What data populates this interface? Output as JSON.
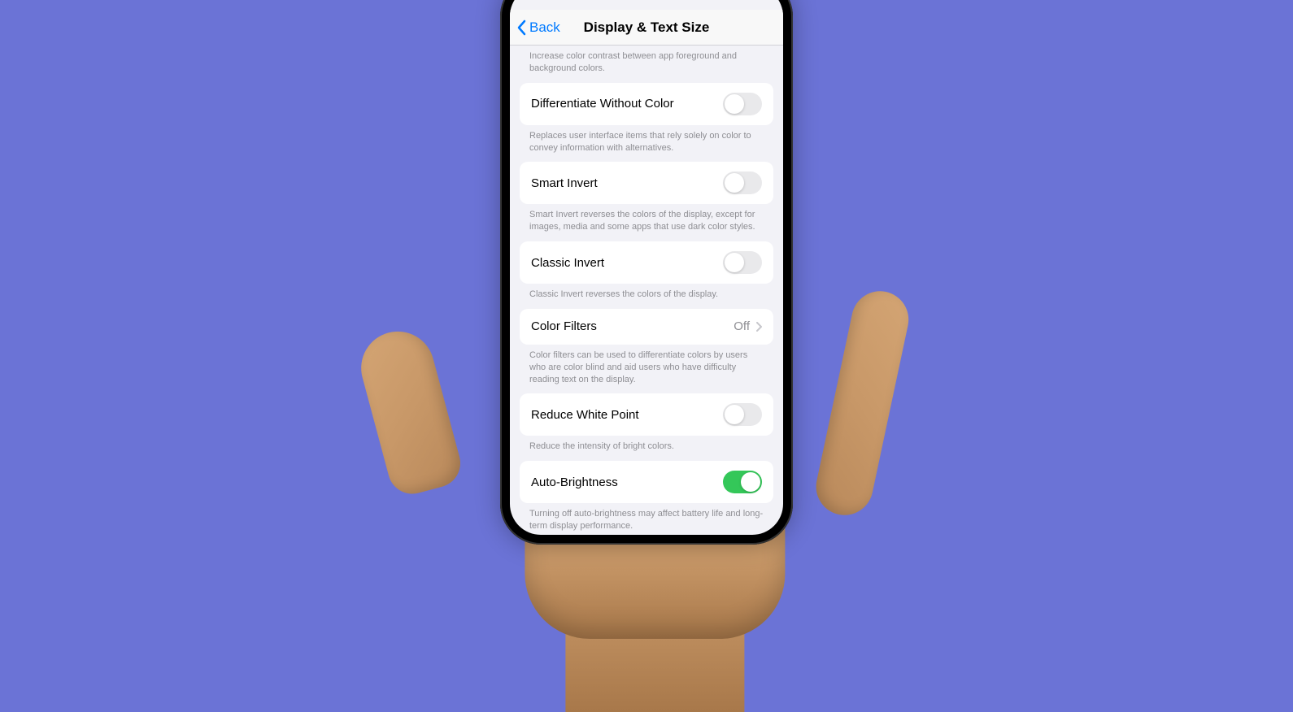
{
  "nav": {
    "back_label": "Back",
    "title": "Display & Text Size"
  },
  "settings": {
    "increase_contrast_desc": "Increase color contrast between app foreground and background colors.",
    "differentiate": {
      "label": "Differentiate Without Color",
      "enabled": false,
      "desc": "Replaces user interface items that rely solely on color to convey information with alternatives."
    },
    "smart_invert": {
      "label": "Smart Invert",
      "enabled": false,
      "desc": "Smart Invert reverses the colors of the display, except for images, media and some apps that use dark color styles."
    },
    "classic_invert": {
      "label": "Classic Invert",
      "enabled": false,
      "desc": "Classic Invert reverses the colors of the display."
    },
    "color_filters": {
      "label": "Color Filters",
      "value": "Off",
      "desc": "Color filters can be used to differentiate colors by users who are color blind and aid users who have difficulty reading text on the display."
    },
    "reduce_white_point": {
      "label": "Reduce White Point",
      "enabled": false,
      "desc": "Reduce the intensity of bright colors."
    },
    "auto_brightness": {
      "label": "Auto-Brightness",
      "enabled": true,
      "desc": "Turning off auto-brightness may affect battery life and long-term display performance."
    }
  }
}
